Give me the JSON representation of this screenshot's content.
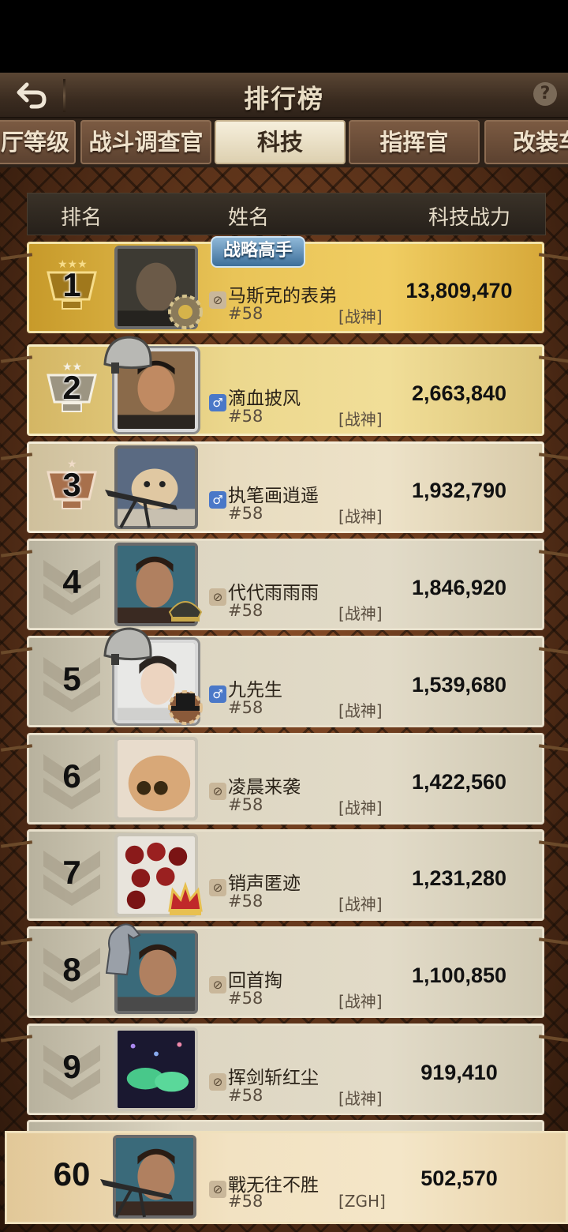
{
  "header": {
    "title": "排行榜",
    "help": "?"
  },
  "tabs": [
    {
      "label": "厅等级"
    },
    {
      "label": "战斗调查官"
    },
    {
      "label": "科技"
    },
    {
      "label": "指挥官"
    },
    {
      "label": "改装车"
    }
  ],
  "columns": {
    "rank": "排名",
    "name": "姓名",
    "power": "科技战力"
  },
  "badge_title": "战略高手",
  "rows": [
    {
      "rank": "1",
      "name": "马斯克的表弟",
      "server": "#58",
      "tag": "[战神]",
      "power": "13,809,470",
      "gender": "hidden"
    },
    {
      "rank": "2",
      "name": "滴血披风",
      "server": "#58",
      "tag": "[战神]",
      "power": "2,663,840",
      "gender": "male"
    },
    {
      "rank": "3",
      "name": "执笔画逍遥",
      "server": "#58",
      "tag": "[战神]",
      "power": "1,932,790",
      "gender": "male"
    },
    {
      "rank": "4",
      "name": "代代雨雨雨",
      "server": "#58",
      "tag": "[战神]",
      "power": "1,846,920",
      "gender": "hidden"
    },
    {
      "rank": "5",
      "name": "九先生",
      "server": "#58",
      "tag": "[战神]",
      "power": "1,539,680",
      "gender": "male"
    },
    {
      "rank": "6",
      "name": "凌晨来袭",
      "server": "#58",
      "tag": "[战神]",
      "power": "1,422,560",
      "gender": "hidden"
    },
    {
      "rank": "7",
      "name": "销声匿迹",
      "server": "#58",
      "tag": "[战神]",
      "power": "1,231,280",
      "gender": "hidden"
    },
    {
      "rank": "8",
      "name": "回首掏",
      "server": "#58",
      "tag": "[战神]",
      "power": "1,100,850",
      "gender": "hidden"
    },
    {
      "rank": "9",
      "name": "挥剑斩红尘",
      "server": "#58",
      "tag": "[战神]",
      "power": "919,410",
      "gender": "hidden"
    }
  ],
  "self": {
    "rank": "60",
    "name": "戰无往不胜",
    "server": "#58",
    "tag": "[ZGH]",
    "power": "502,570",
    "gender": "hidden"
  },
  "gender_symbols": {
    "male": "♂",
    "hidden": "⊘"
  }
}
